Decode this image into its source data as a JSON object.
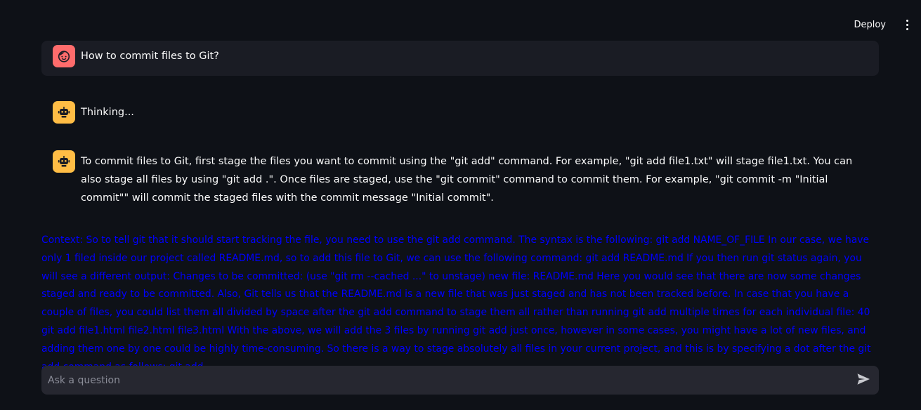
{
  "header": {
    "deploy_label": "Deploy",
    "menu_icon": "more-vertical-icon"
  },
  "messages": [
    {
      "role": "user",
      "avatar_icon": "user-face-icon",
      "avatar_color": "#ff6c6c",
      "text": "How to commit files to Git?"
    },
    {
      "role": "assistant",
      "avatar_icon": "robot-icon",
      "avatar_color": "#ffbd45",
      "text": "Thinking..."
    },
    {
      "role": "assistant",
      "avatar_icon": "robot-icon",
      "avatar_color": "#ffbd45",
      "text": "To commit files to Git, first stage the files you want to commit using the \"git add\" command. For example, \"git add file1.txt\" will stage file1.txt. You can also stage all files by using \"git add .\". Once files are staged, use the \"git commit\" command to commit them. For example, \"git commit -m \"Initial commit\"\" will commit the staged files with the commit message \"Initial commit\"."
    }
  ],
  "context": {
    "text": "Context: So to tell git that it should start tracking the file, you need to use the git add command. The syntax is the following: git add NAME_OF_FILE In our case, we have only 1 filed inside our project called README.md, so to add this file to Git, we can use the following command: git add README.md If you then run git status again, you will see a different output: Changes to be committed: (use \"git rm --cached ...\" to unstage) new file: README.md Here you would see that there are now some changes staged and ready to be committed. Also, Git tells us that the README.md is a new file that was just staged and has not been tracked before. In case that you have a couple of files, you could list them all divided by space after the git add command to stage them all rather than running git add multiple times for each individual file: 40 git add file1.html file2.html file3.html With the above, we will add the 3 files by running git add just once, however in some cases, you might have a lot of new files, and adding them one by one could be highly time-consuming. So there is a way to stage absolutely all files in your current project, and this is by specifying a dot after the git add command as follows: git add .",
    "color": "#0000ff"
  },
  "input": {
    "placeholder": "Ask a question",
    "value": "",
    "send_icon": "send-icon"
  }
}
